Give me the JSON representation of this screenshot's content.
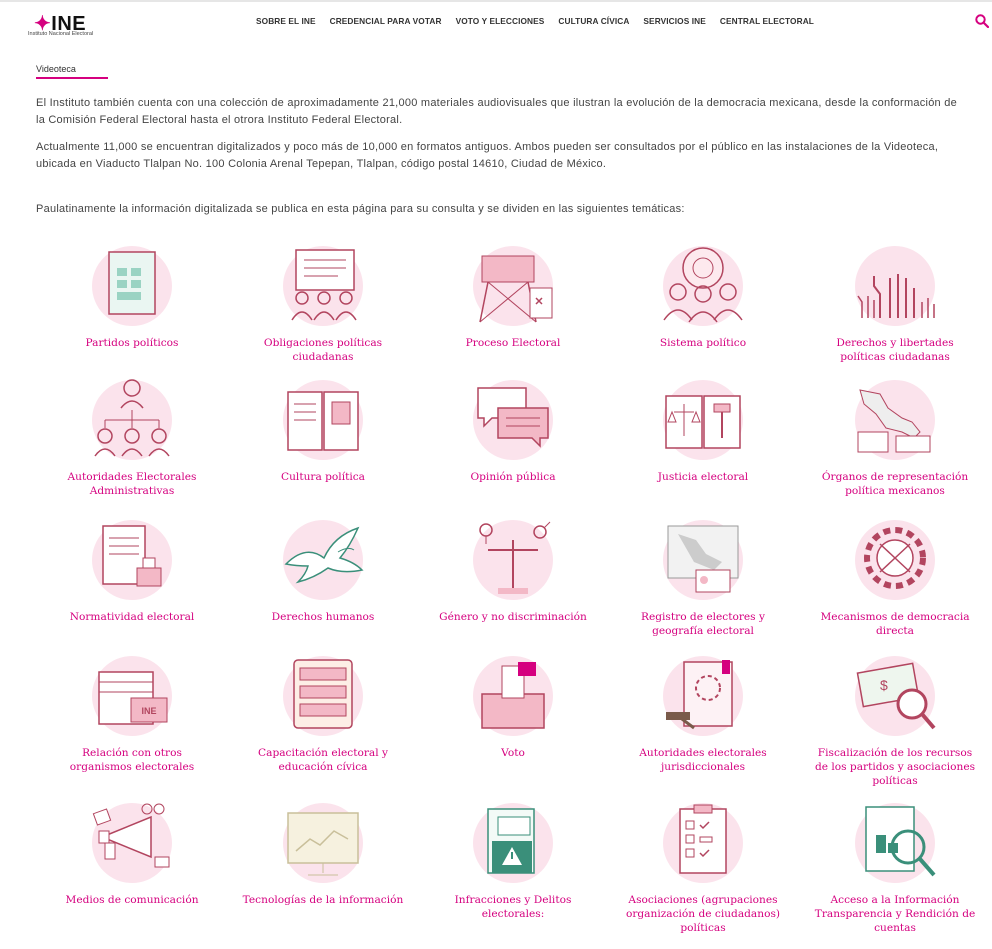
{
  "header": {
    "logo_text": "INE",
    "logo_subtitle": "Instituto Nacional Electoral",
    "nav": [
      "SOBRE EL INE",
      "CREDENCIAL PARA VOTAR",
      "VOTO Y ELECCIONES",
      "CULTURA CÍVICA",
      "SERVICIOS INE",
      "CENTRAL ELECTORAL"
    ],
    "search_icon": "search-icon"
  },
  "breadcrumb": "Videoteca",
  "paragraphs": [
    "El Instituto también cuenta con una colección de aproximadamente 21,000 materiales audiovisuales que ilustran la evolución de la democracia mexicana, desde la conformación de la Comisión Federal Electoral hasta el otrora Instituto Federal Electoral.",
    "Actualmente 11,000 se encuentran digitalizados y poco más de 10,000 en formatos antiguos. Ambos pueden ser consultados por el público en las instalaciones de la Videoteca, ubicada en Viaducto Tlalpan No. 100 Colonia Arenal Tepepan, Tlalpan, código postal 14610, Ciudad de México.",
    "Paulatinamente la información digitalizada se publica en esta página para su consulta y se dividen en las siguientes temáticas:"
  ],
  "topics": [
    {
      "label": "Partidos políticos",
      "icon": "document-grid-icon"
    },
    {
      "label": "Obligaciones políticas ciudadanas",
      "icon": "citizens-document-icon"
    },
    {
      "label": "Proceso Electoral",
      "icon": "voting-booth-icon"
    },
    {
      "label": "Sistema político",
      "icon": "assembly-icon"
    },
    {
      "label": "Derechos y libertades políticas ciudadanas",
      "icon": "raised-hands-icon"
    },
    {
      "label": "Autoridades Electorales Administrativas",
      "icon": "org-chart-icon"
    },
    {
      "label": "Cultura política",
      "icon": "open-book-icon"
    },
    {
      "label": "Opinión pública",
      "icon": "speech-bubbles-icon"
    },
    {
      "label": "Justicia electoral",
      "icon": "law-book-icon"
    },
    {
      "label": "Órganos de representación política mexicanos",
      "icon": "mexico-map-buildings-icon"
    },
    {
      "label": "Normatividad electoral",
      "icon": "document-stamp-icon"
    },
    {
      "label": "Derechos humanos",
      "icon": "dove-icon"
    },
    {
      "label": "Género y no discriminación",
      "icon": "gender-scale-icon"
    },
    {
      "label": "Registro de electores y geografía electoral",
      "icon": "map-id-card-icon"
    },
    {
      "label": "Mecanismos de democracia directa",
      "icon": "gear-icon"
    },
    {
      "label": "Relación con otros organismos electorales",
      "icon": "ine-building-icon"
    },
    {
      "label": "Capacitación electoral y educación cívica",
      "icon": "chalkboard-icon"
    },
    {
      "label": "Voto",
      "icon": "ballot-box-icon"
    },
    {
      "label": "Autoridades electorales jurisdiccionales",
      "icon": "gavel-book-icon"
    },
    {
      "label": "Fiscalización de los recursos de los partidos y asociaciones políticas",
      "icon": "money-magnifier-icon"
    },
    {
      "label": "Medios de comunicación",
      "icon": "megaphone-icon"
    },
    {
      "label": "Tecnologías de la información",
      "icon": "monitor-chart-icon"
    },
    {
      "label": "Infracciones y Delitos electorales:",
      "icon": "warning-document-icon"
    },
    {
      "label": "Asociaciones (agrupaciones organización de ciudadanos) políticas",
      "icon": "checklist-icon"
    },
    {
      "label": "Acceso a la Información Transparencia y Rendición de cuentas",
      "icon": "document-search-icon"
    }
  ],
  "colors": {
    "accent": "#d5007f",
    "icon_stroke": "#b2455f",
    "icon_fill": "#f3b8c6",
    "circle": "#fbe3ec"
  }
}
